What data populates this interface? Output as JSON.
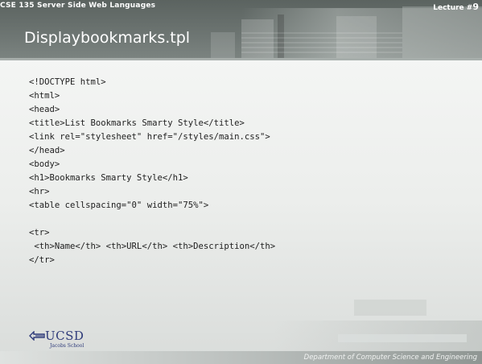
{
  "header": {
    "course": "CSE 135   Server Side Web Languages",
    "lecture_label": "Lecture #",
    "lecture_number": "9",
    "title": "Displaybookmarks.tpl"
  },
  "code_lines": [
    "<!DOCTYPE html>",
    "<html>",
    "<head>",
    "<title>List Bookmarks Smarty Style</title>",
    "<link rel=\"stylesheet\" href=\"/styles/main.css\">",
    "</head>",
    "<body>",
    "<h1>Bookmarks Smarty Style</h1>",
    "<hr>",
    "<table cellspacing=\"0\" width=\"75%\">",
    "",
    "<tr>",
    " <th>Name</th> <th>URL</th> <th>Description</th>",
    "</tr>"
  ],
  "footer": {
    "logo_text": "UCSD",
    "logo_subtext": "Jacobs School",
    "department": "Department of Computer Science and Engineering"
  },
  "colors": {
    "header_bg": "#6d7572",
    "logo_blue": "#2f3b7a"
  },
  "icons": {
    "logo": "ucsd-trident-logo-icon"
  }
}
